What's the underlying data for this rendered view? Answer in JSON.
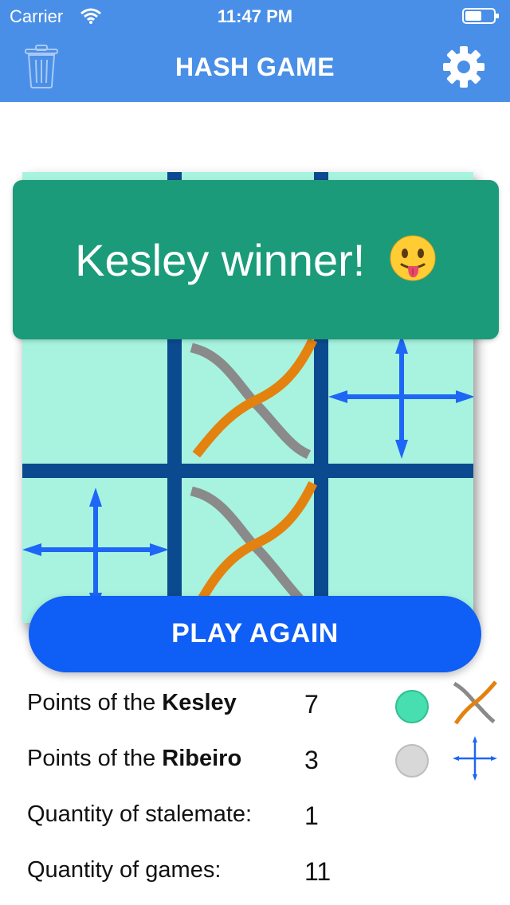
{
  "status": {
    "carrier": "Carrier",
    "time": "11:47 PM"
  },
  "nav": {
    "title": "HASH GAME",
    "left_icon": "trash-icon",
    "right_icon": "gear-icon"
  },
  "board": {
    "cells": [
      [
        "",
        "x",
        ""
      ],
      [
        "",
        "x",
        "plus"
      ],
      [
        "plus",
        "x",
        ""
      ]
    ],
    "colors": {
      "background": "#a7f3df",
      "grid": "#0b4a8f",
      "x_orange": "#e3820f",
      "x_gray": "#8a8a8a",
      "plus": "#1e66f5"
    }
  },
  "winner_banner": {
    "message": "Kesley winner!",
    "emoji": "tongue-out-face-icon"
  },
  "play_again": {
    "label": "PLAY AGAIN"
  },
  "stats": [
    {
      "prefix": "Points of the ",
      "name": "Kesley",
      "value": "7",
      "color": "#47dfb0",
      "symbol": "x"
    },
    {
      "prefix": "Points of the ",
      "name": "Ribeiro",
      "value": "3",
      "color": "#d8d8d8",
      "symbol": "plus"
    },
    {
      "prefix": "Quantity of stalemate:",
      "name": "",
      "value": "1"
    },
    {
      "prefix": "Quantity of games:",
      "name": "",
      "value": "11"
    }
  ]
}
